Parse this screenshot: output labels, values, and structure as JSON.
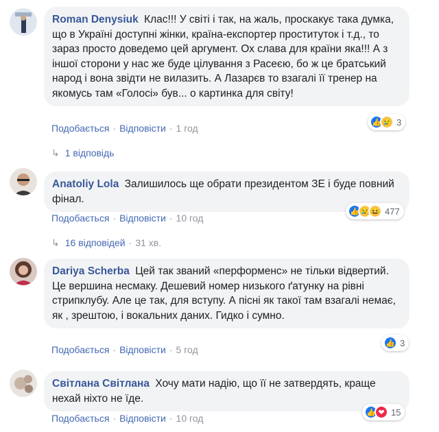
{
  "colors": {
    "accent": "#4267b2",
    "author": "#385898",
    "bubble": "#f2f3f5",
    "meta": "#90949c"
  },
  "comments": [
    {
      "author": "Roman Denysiuk",
      "text": "Клас!!! У світі і так, на жаль, проскакує така думка, що в Україні доступні жінки, країна-експортер проституток і т.д., то зараз просто доведемо цей аргумент. Ох слава для країни яка!!! А з іншої сторони у нас же буде цілування з Расеєю, бо ж це братський народ і вона звідти не вилазить. А Лазарєв то взагалі її тренер на якомусь там «Голосі» був... о картинка для світу!",
      "like": "Подобається",
      "reply": "Відповісти",
      "time": "1 год",
      "reactions": {
        "icons": [
          "like-icon",
          "sad-icon"
        ],
        "count": "3"
      },
      "replies": {
        "label": "1 відповідь",
        "time": ""
      }
    },
    {
      "author": "Anatoliy Lola",
      "text": "Залишилось ще обрати президентом ЗЕ і буде повний фінал.",
      "like": "Подобається",
      "reply": "Відповісти",
      "time": "10 год",
      "reactions": {
        "icons": [
          "like-icon",
          "sad-icon",
          "haha-icon"
        ],
        "count": "477"
      },
      "replies": {
        "label": "16 відповідей",
        "time": "31 хв."
      }
    },
    {
      "author": "Dariya Scherba",
      "text": "Цей так званий «перформенс» не тільки відвертий. Це вершина несмаку. Дешевий номер низького ґатунку на рівні стрипклубу. Але це так, для вступу. А пісні як такої там взагалі немає, як , зрештою, і вокальних даних. Гидко і сумно.",
      "like": "Подобається",
      "reply": "Відповісти",
      "time": "5 год",
      "reactions": {
        "icons": [
          "like-icon"
        ],
        "count": "3"
      }
    },
    {
      "author": "Світлана Світлана",
      "text": "Хочу мати надію, що її не затвердять, краще нехай ніхто не їде.",
      "like": "Подобається",
      "reply": "Відповісти",
      "time": "10 год",
      "reactions": {
        "icons": [
          "like-icon",
          "love-icon"
        ],
        "count": "15"
      }
    }
  ],
  "separator": "·"
}
